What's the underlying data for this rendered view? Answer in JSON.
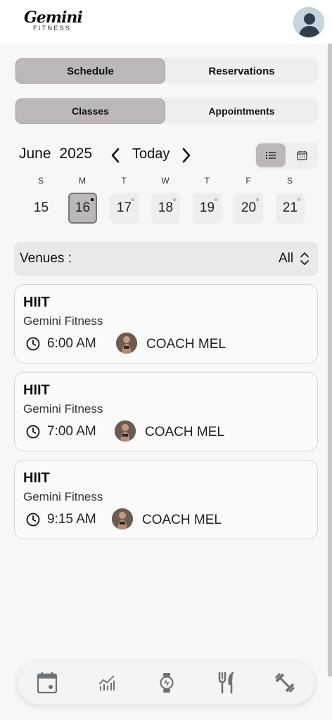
{
  "header": {
    "logo_script": "Gemini",
    "logo_sub": "FITNESS",
    "avatar_icon": "user-silhouette-icon"
  },
  "tabs_primary": {
    "left": "Schedule",
    "right": "Reservations",
    "active": "Schedule"
  },
  "tabs_secondary": {
    "left": "Classes",
    "right": "Appointments",
    "active": "Classes"
  },
  "calendar": {
    "month": "June",
    "year": "2025",
    "today_label": "Today",
    "view_modes": [
      "list-icon",
      "calendar-icon"
    ],
    "active_view": "list",
    "days": [
      {
        "letter": "S",
        "date": "15",
        "state": "past"
      },
      {
        "letter": "M",
        "date": "16",
        "state": "selected"
      },
      {
        "letter": "T",
        "date": "17",
        "state": "future"
      },
      {
        "letter": "W",
        "date": "18",
        "state": "future"
      },
      {
        "letter": "T",
        "date": "19",
        "state": "future"
      },
      {
        "letter": "F",
        "date": "20",
        "state": "future"
      },
      {
        "letter": "S",
        "date": "21",
        "state": "future"
      }
    ]
  },
  "venues": {
    "label": "Venues :",
    "value": "All"
  },
  "classes": [
    {
      "title": "HIIT",
      "venue": "Gemini Fitness",
      "time": "6:00 AM",
      "coach": "COACH MEL"
    },
    {
      "title": "HIIT",
      "venue": "Gemini Fitness",
      "time": "7:00 AM",
      "coach": "COACH MEL"
    },
    {
      "title": "HIIT",
      "venue": "Gemini Fitness",
      "time": "9:15 AM",
      "coach": "COACH MEL"
    }
  ],
  "bottom_nav": [
    "calendar-icon",
    "chart-icon",
    "smartwatch-icon",
    "fork-knife-icon",
    "dumbbell-icon"
  ],
  "colors": {
    "active_segment": "#bcb8b8",
    "background": "#f7f7f7",
    "icon_gray": "#6b7378"
  }
}
